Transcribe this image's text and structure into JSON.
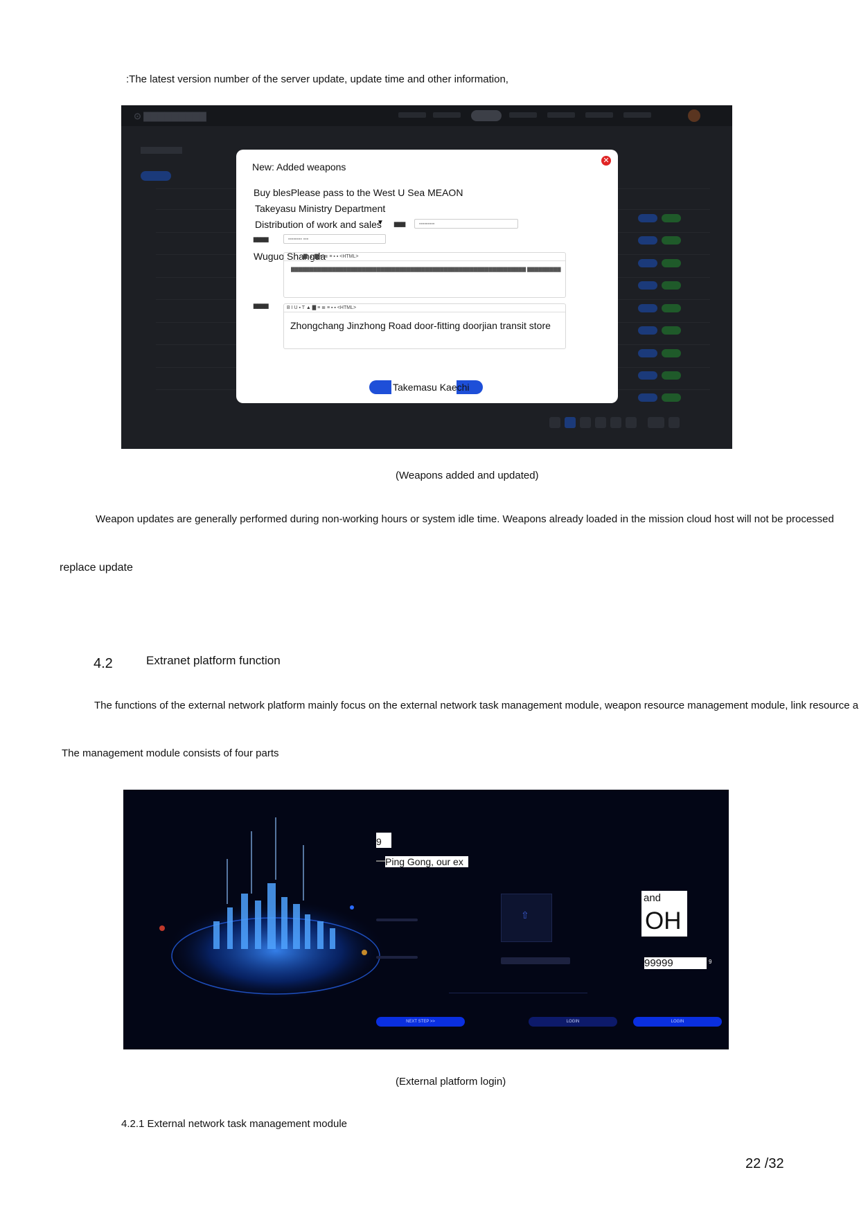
{
  "header_line": ":The latest version number of the server update, update time and other information,",
  "weapon_modal": {
    "title": "New: Added weapons",
    "line1": "Buy blesPlease pass to the West U Sea MEAON",
    "line2": "Takeyasu Ministry Department",
    "line3": "Distribution of work and sales",
    "dropdown_icon": "caret-down-icon",
    "line4": "Wuguo Shangda",
    "line5": "Zhongchang Jinzhong Road door-fitting doorjian transit store",
    "submit_label": "Takemasu Kaechi",
    "close_icon": "close-icon"
  },
  "caption1": "(Weapons added and updated)",
  "paragraph1": "Weapon updates are generally performed during non-working hours or system idle time. Weapons already loaded in the mission cloud host will not be processed",
  "paragraph1_cont": "replace update",
  "section": {
    "number": "4.2",
    "title": "Extranet platform function"
  },
  "paragraph2": "The functions of the external network platform mainly focus on the external network task management module, weapon resource management module, link resource appli",
  "paragraph2_cont": "The management module consists of four parts",
  "login_screen": {
    "badge_number": "9",
    "greeting": "Ping Gong, our ex",
    "box_word": "and",
    "box_big": "OH",
    "code_value": "99999",
    "code_suffix": "9",
    "buttons": [
      "NEXT STEP >>",
      "LOGIN",
      "LOGIN"
    ]
  },
  "caption2": "(External platform login)",
  "subsection": "4.2.1 External network task management module",
  "page_number": "22 /32",
  "colors": {
    "accent_blue": "#1e4fd8",
    "dark_bg": "#1d1f24",
    "login_bg": "#030616",
    "close_red": "#e02424"
  }
}
